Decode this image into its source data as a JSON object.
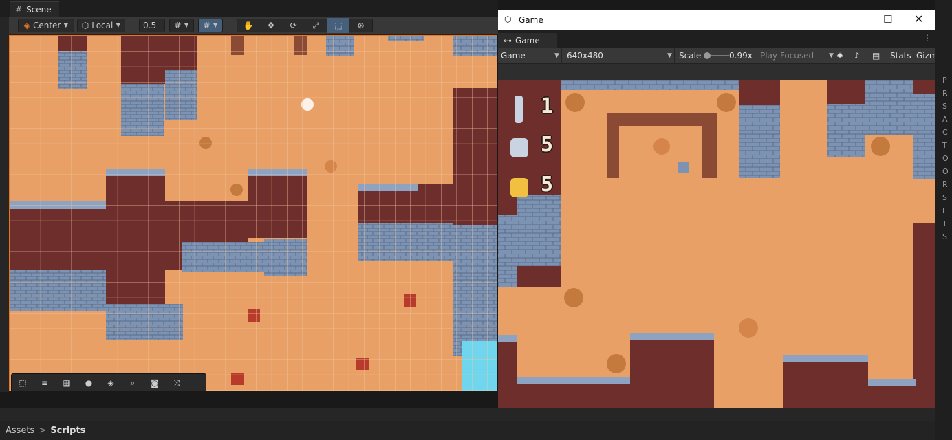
{
  "scene": {
    "tab_label": "Scene",
    "pivot_label": "Center",
    "space_label": "Local",
    "snap_value": "0.5"
  },
  "game": {
    "window_title": "Game",
    "tab_label": "Game",
    "display_label": "Game",
    "resolution_label": "640x480",
    "scale_label": "Scale",
    "scale_value": "0.99x",
    "scale_fraction": 0.05,
    "play_mode_label": "Play Focused",
    "stats_label": "Stats",
    "gizmos_label": "Gizm",
    "hud": {
      "sword_count": "1",
      "bomb_count": "5",
      "coin_count": "5"
    }
  },
  "breadcrumb": {
    "root": "Assets",
    "separator": ">",
    "current": "Scripts"
  },
  "colors": {
    "sand": "#e8a066",
    "pit": "#6e2e2c",
    "wall": "#7d93b4",
    "scene_border": "#e8761e",
    "water": "#6fd6ee"
  },
  "right_panel_letters": [
    "P",
    "R",
    "S",
    "A",
    "C",
    "T",
    "O",
    "O",
    "R",
    "S",
    "I",
    "T",
    "S"
  ]
}
